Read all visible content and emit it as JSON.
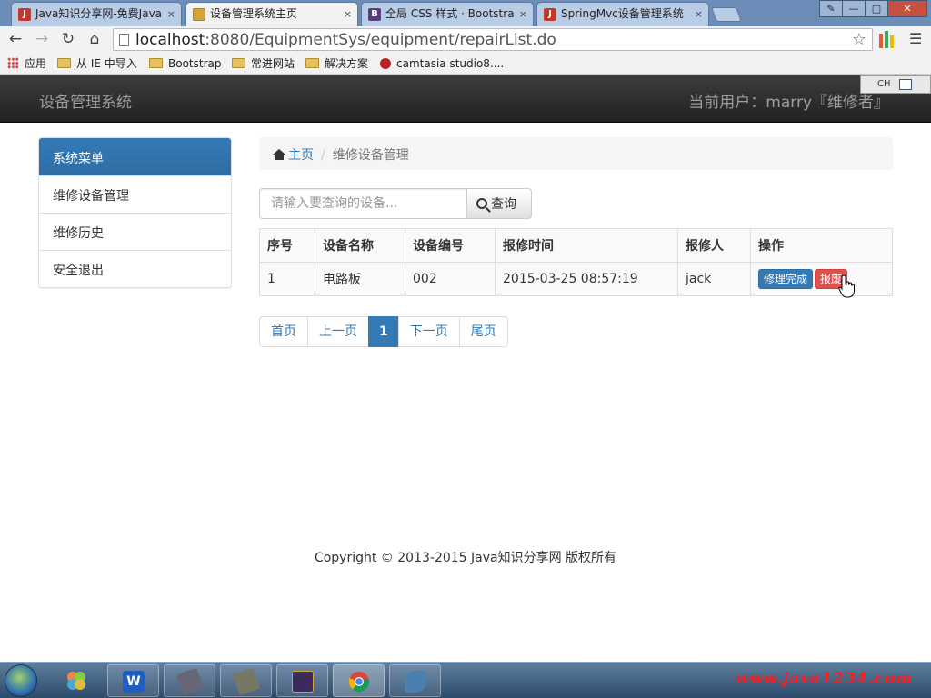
{
  "browser": {
    "tabs": [
      {
        "title": "Java知识分享网-免费Java",
        "fav": "J",
        "fav_color": "#c0392b"
      },
      {
        "title": "设备管理系统主页",
        "fav": "",
        "fav_color": "#d9a430"
      },
      {
        "title": "全局 CSS 样式 · Bootstra",
        "fav": "B",
        "fav_color": "#563d7c"
      },
      {
        "title": "SpringMvc设备管理系统",
        "fav": "J",
        "fav_color": "#c0392b"
      }
    ],
    "tab_close": "×",
    "url_host": "localhost",
    "url_rest": ":8080/EquipmentSys/equipment/repairList.do",
    "bookmarks": [
      "应用",
      "从 IE 中导入",
      "Bootstrap",
      "常进网站",
      "解决方案",
      "camtasia studio8...."
    ]
  },
  "navbar": {
    "brand": "设备管理系统",
    "current_user": "当前用户：marry『维修者』",
    "ime_label": "CH"
  },
  "sidebar": {
    "header": "系统菜单",
    "items": [
      "维修设备管理",
      "维修历史",
      "安全退出"
    ]
  },
  "breadcrumb": {
    "home": "主页",
    "separator": "/",
    "current": "维修设备管理"
  },
  "search": {
    "placeholder": "请输入要查询的设备...",
    "button": "查询"
  },
  "table": {
    "headers": [
      "序号",
      "设备名称",
      "设备编号",
      "报修时间",
      "报修人",
      "操作"
    ],
    "rows": [
      {
        "no": "1",
        "name": "电路板",
        "code": "002",
        "time": "2015-03-25 08:57:19",
        "reporter": "jack",
        "action_done": "修理完成",
        "action_scrap": "报废"
      }
    ]
  },
  "pagination": {
    "first": "首页",
    "prev": "上一页",
    "current": "1",
    "next": "下一页",
    "last": "尾页"
  },
  "footer": {
    "copyright": "Copyright © 2013-2015 Java知识分享网 版权所有"
  },
  "taskbar": {
    "watermark": "www.java1234.com"
  },
  "colors": {
    "primary": "#337ab7",
    "danger": "#d9534f",
    "navbar_bg": "#222222"
  }
}
